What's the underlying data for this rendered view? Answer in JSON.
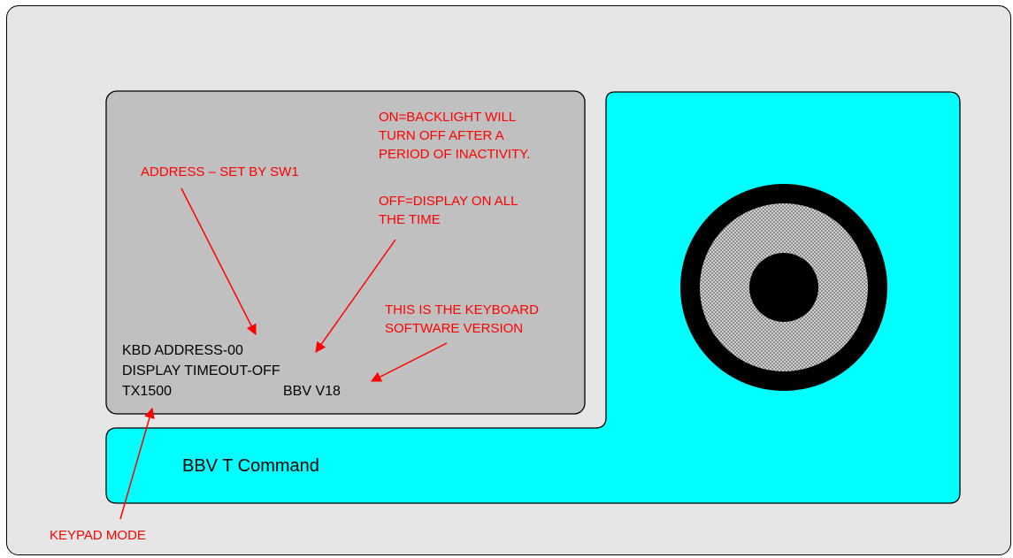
{
  "display": {
    "line1": "KBD ADDRESS-00",
    "line2": "DISPLAY TIMEOUT-OFF",
    "line3_left": "TX1500",
    "line3_right": "BBV V18"
  },
  "device": {
    "brand_label": "BBV T Command"
  },
  "annotations": {
    "address_note": "ADDRESS – SET BY SW1",
    "backlight_on_note": [
      "ON=BACKLIGHT WILL",
      "TURN OFF AFTER A",
      "PERIOD OF INACTIVITY."
    ],
    "backlight_off_note": [
      "OFF=DISPLAY ON ALL",
      "THE TIME"
    ],
    "version_note": [
      "THIS IS THE KEYBOARD",
      "SOFTWARE VERSION"
    ],
    "keypad_note": "KEYPAD MODE"
  },
  "colors": {
    "device_body": "#00ffff",
    "lcd_screen": "#c0c0c0",
    "annotation": "#ff0000",
    "joystick_ring": "#000000",
    "joystick_mid": "#b4b4b4"
  }
}
